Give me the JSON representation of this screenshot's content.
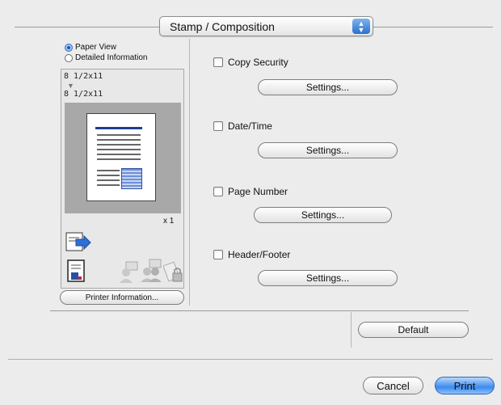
{
  "popup": {
    "label": "Stamp / Composition"
  },
  "preview": {
    "radio_options": [
      {
        "label": "Paper View",
        "selected": true
      },
      {
        "label": "Detailed Information",
        "selected": false
      }
    ],
    "original_size": "8 1/2x11",
    "output_size": "8 1/2x11",
    "copies": "x 1",
    "printer_info_button": "Printer Information..."
  },
  "options": [
    {
      "label": "Copy Security",
      "checked": false,
      "settings": "Settings..."
    },
    {
      "label": "Date/Time",
      "checked": false,
      "settings": "Settings..."
    },
    {
      "label": "Page Number",
      "checked": false,
      "settings": "Settings..."
    },
    {
      "label": "Header/Footer",
      "checked": false,
      "settings": "Settings..."
    }
  ],
  "default_button": "Default",
  "footer": {
    "cancel": "Cancel",
    "print": "Print"
  },
  "colors": {
    "accent": "#2a6fd0",
    "print_button": "#3b8af0",
    "page_bar": "#1c3f8e"
  }
}
